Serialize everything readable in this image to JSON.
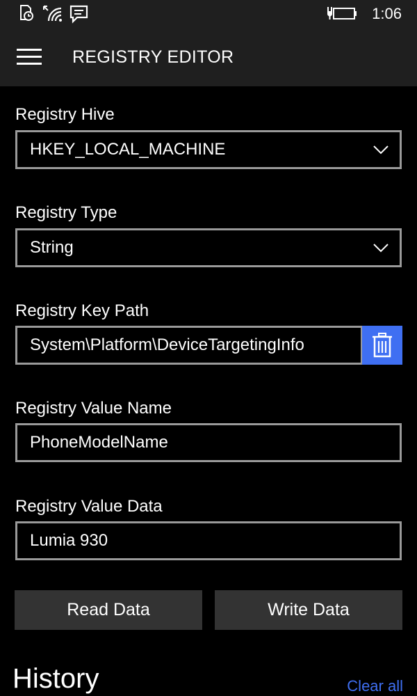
{
  "status_bar": {
    "time": "1:06",
    "icons": [
      "notification-clock-icon",
      "wifi-icon",
      "message-icon",
      "battery-charging-icon"
    ]
  },
  "header": {
    "menu_icon": "hamburger-menu-icon",
    "title": "REGISTRY EDITOR"
  },
  "form": {
    "hive": {
      "label": "Registry Hive",
      "value": "HKEY_LOCAL_MACHINE"
    },
    "type": {
      "label": "Registry Type",
      "value": "String"
    },
    "key_path": {
      "label": "Registry Key Path",
      "value": "System\\Platform\\DeviceTargetingInfo"
    },
    "value_name": {
      "label": "Registry Value Name",
      "value": "PhoneModelName"
    },
    "value_data": {
      "label": "Registry Value Data",
      "value": "Lumia 930"
    }
  },
  "actions": {
    "read_label": "Read Data",
    "write_label": "Write Data"
  },
  "history": {
    "title": "History",
    "clear_label": "Clear all"
  },
  "colors": {
    "accent": "#3f6ff2",
    "background": "#000000",
    "header_background": "#1f1f1f",
    "field_border": "#9a9a9a",
    "button_background": "#333333"
  }
}
